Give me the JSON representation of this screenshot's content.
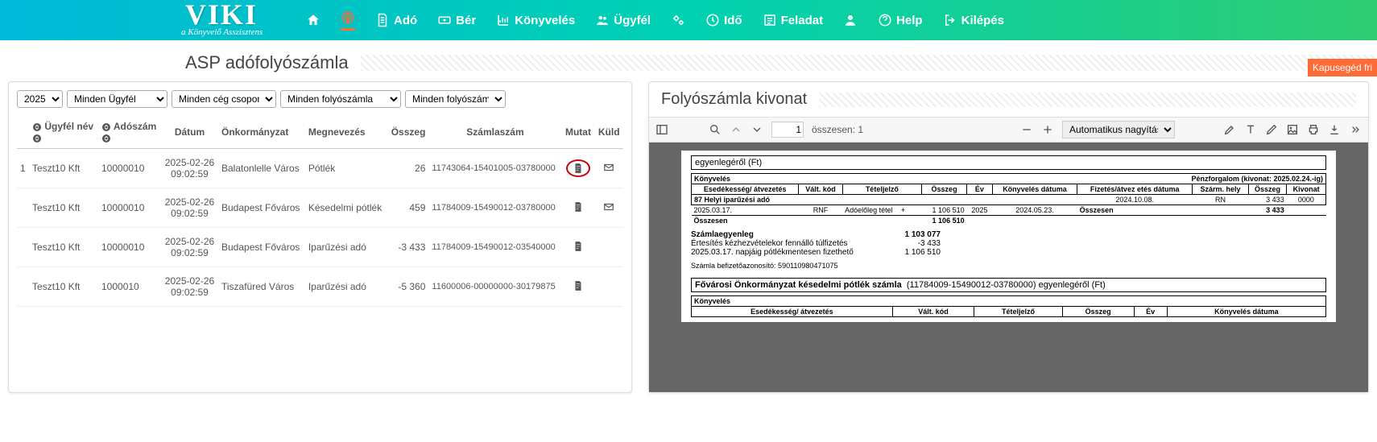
{
  "logo": {
    "main": "VIKI",
    "sub": "a Könyvelő Asszisztens"
  },
  "nav": {
    "ado": "Adó",
    "ber": "Bér",
    "konyveles": "Könyvelés",
    "ugyfel": "Ügyfél",
    "ido": "Idő",
    "feladat": "Feladat",
    "help": "Help",
    "kilepes": "Kilépés"
  },
  "page_title": "ASP adófolyószámla",
  "kapuseged": "Kapusegéd fri",
  "filters": {
    "year": "2025",
    "ugyfel": "Minden Ügyfél",
    "cegsoport": "Minden cég csoport",
    "foly1": "Minden folyószámla",
    "foly2": "Minden folyószámla"
  },
  "table": {
    "headers": {
      "idx": "",
      "ugyfel": "Ügyfél név",
      "adoszam": "Adószám",
      "datum": "Dátum",
      "onk": "Önkormányzat",
      "megn": "Megnevezés",
      "osszeg": "Összeg",
      "szamla": "Számlaszám",
      "mutat": "Mutat",
      "kuld": "Küld"
    },
    "rows": [
      {
        "idx": "1",
        "ugyfel": "Teszt10 Kft",
        "adoszam": "10000010",
        "datum": "2025-02-26 09:02:59",
        "onk": "Balatonlelle Város",
        "megn": "Pótlék",
        "osszeg": "26",
        "osszeg_cls": "pos",
        "szamla": "11743064-15401005-03780000",
        "kuld": true,
        "circle": true
      },
      {
        "idx": "",
        "ugyfel": "Teszt10 Kft",
        "adoszam": "10000010",
        "datum": "2025-02-26 09:02:59",
        "onk": "Budapest Főváros",
        "megn": "Késedelmi pótlék",
        "osszeg": "459",
        "osszeg_cls": "pos",
        "szamla": "11784009-15490012-03780000",
        "kuld": true,
        "circle": false
      },
      {
        "idx": "",
        "ugyfel": "Teszt10 Kft",
        "adoszam": "10000010",
        "datum": "2025-02-26 09:02:59",
        "onk": "Budapest Főváros",
        "megn": "Iparűzési adó",
        "osszeg": "-3 433",
        "osszeg_cls": "neg",
        "szamla": "11784009-15490012-03540000",
        "kuld": false,
        "circle": false
      },
      {
        "idx": "",
        "ugyfel": "Teszt10 Kft",
        "adoszam": "1000010",
        "datum": "2025-02-26 09:02:59",
        "onk": "Tiszafüred Város",
        "megn": "Iparűzési adó",
        "osszeg": "-5 360",
        "osszeg_cls": "neg",
        "szamla": "11600006-00000000-30179875",
        "kuld": false,
        "circle": false
      }
    ]
  },
  "right": {
    "title": "Folyószámla kivonat",
    "toolbar": {
      "page": "1",
      "total": "összesen: 1",
      "zoom": "Automatikus nagyítás"
    }
  },
  "doc": {
    "top_hdr": "egyenlegéről (Ft)",
    "section1_label": "Könyvelés",
    "penzforgalom": "Pénzforgalom (kivonat: 2025.02.24.-ig)",
    "cols": {
      "esed": "Esedékesség/ átvezetés",
      "valt": "Vált. kód",
      "tetel": "Tételjelző",
      "osszeg": "Összeg",
      "ev": "Év",
      "konyv_d": "Könyvelés dátuma",
      "fiz_d": "Fizetés/átvez etés dátuma",
      "szarm": "Szárm. hely",
      "osszeg2": "Összeg",
      "kivonat": "Kivonat"
    },
    "subhead": "87 Helyi iparűzési adó",
    "penz_row": {
      "fiz": "2024.10.08.",
      "szarm": "RN",
      "osszeg": "3 433",
      "kivonat": "0000"
    },
    "row": {
      "esed": "2025.03.17.",
      "valt": "RNF",
      "tetel": "Adóelőleg tétel",
      "plus": "+",
      "osszeg": "1 106 510",
      "ev": "2025",
      "konyv_d": "2024.05.23."
    },
    "osszesen_label": "Összesen",
    "osszesen_k": "1 106 510",
    "osszesen_p": "3 433",
    "balance": {
      "l1": "Számlaegyenleg",
      "v1": "1 103 077",
      "l2": "Értesítés kézhezvételekor fennálló túlfizetés",
      "v2": "-3 433",
      "l3": "2025.03.17. napjáig pótlékmentesen fizethető",
      "v3": "1 106 510"
    },
    "id_line": "Számla befizetőazonosító: 590110980471075",
    "acct2_title": "Fővárosi Önkormányzat késedelmi pótlék számla",
    "acct2_num": "(11784009-15490012-03780000) egyenlegéről (Ft)",
    "section2_label": "Könyvelés"
  }
}
